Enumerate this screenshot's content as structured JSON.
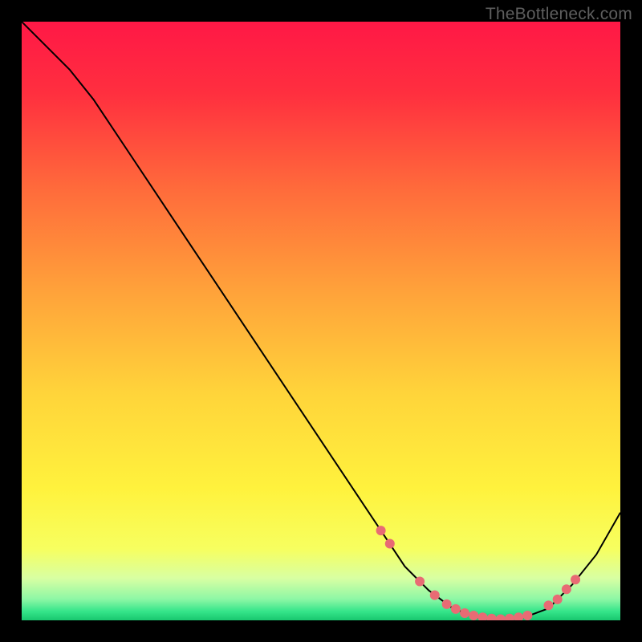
{
  "watermark": "TheBottleneck.com",
  "chart_data": {
    "type": "line",
    "title": "",
    "xlabel": "",
    "ylabel": "",
    "xlim": [
      0,
      100
    ],
    "ylim": [
      0,
      100
    ],
    "grid": false,
    "series": [
      {
        "name": "curve",
        "x": [
          0,
          8,
          12,
          18,
          24,
          30,
          36,
          42,
          48,
          54,
          60,
          64,
          68,
          72,
          76,
          80,
          84,
          88,
          92,
          96,
          100
        ],
        "values": [
          100,
          92,
          87,
          78,
          69,
          60,
          51,
          42,
          33,
          24,
          15,
          9,
          5,
          2,
          0.5,
          0.2,
          0.5,
          2,
          6,
          11,
          18
        ]
      }
    ],
    "marker_points": {
      "x": [
        60,
        61.5,
        66.5,
        69,
        71,
        72.5,
        74,
        75.5,
        77,
        78.5,
        80,
        81.5,
        83,
        84.5,
        88,
        89.5,
        91,
        92.5
      ],
      "values": [
        15,
        12.8,
        6.5,
        4.2,
        2.7,
        1.9,
        1.2,
        0.8,
        0.5,
        0.3,
        0.2,
        0.3,
        0.5,
        0.8,
        2.5,
        3.5,
        5.2,
        6.8
      ]
    },
    "gradient_stops": [
      {
        "pos": 0.0,
        "color": "#ff1846"
      },
      {
        "pos": 0.12,
        "color": "#ff2f3f"
      },
      {
        "pos": 0.28,
        "color": "#ff6b3b"
      },
      {
        "pos": 0.45,
        "color": "#ffa23a"
      },
      {
        "pos": 0.62,
        "color": "#ffd43a"
      },
      {
        "pos": 0.78,
        "color": "#fff23d"
      },
      {
        "pos": 0.88,
        "color": "#f7ff5f"
      },
      {
        "pos": 0.93,
        "color": "#d8ffa3"
      },
      {
        "pos": 0.965,
        "color": "#8cf7a5"
      },
      {
        "pos": 0.985,
        "color": "#35e58a"
      },
      {
        "pos": 1.0,
        "color": "#18c76e"
      }
    ],
    "marker_color": "#e86b74",
    "line_color": "#000000"
  }
}
